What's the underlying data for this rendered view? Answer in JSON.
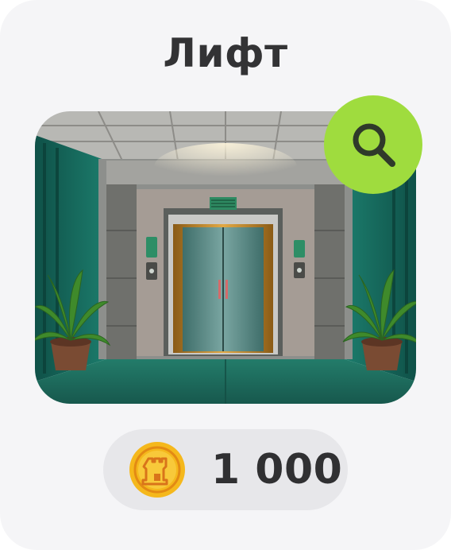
{
  "item": {
    "title": "Лифт",
    "image_icon": "elevator-lobby-illustration",
    "zoom_icon": "search-icon",
    "price": "1 000",
    "currency_icon": "coin-tower-icon"
  },
  "colors": {
    "card_bg": "#f5f5f7",
    "accent_green": "#9fdc3e",
    "pill_bg": "#e7e7ea",
    "coin_gold": "#f5b81c"
  }
}
